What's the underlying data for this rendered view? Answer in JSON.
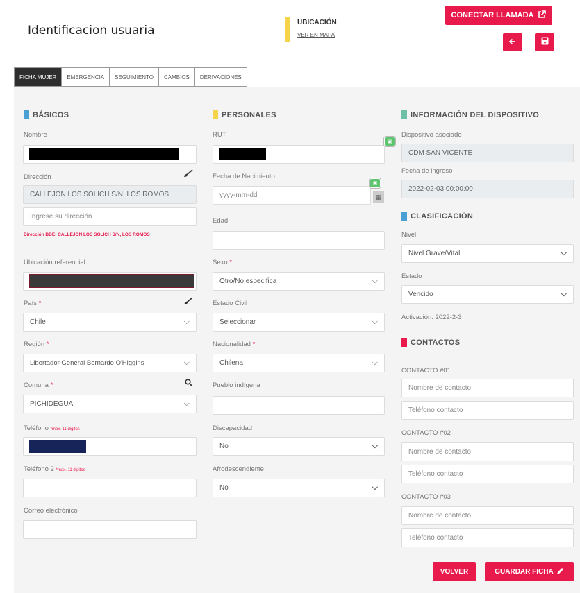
{
  "header": {
    "title": "Identificacion usuaria",
    "ubicacion_title": "UBICACIÓN",
    "ver_mapa": "VER EN MAPA",
    "call_label": "CONECTAR LLAMADA",
    "back_icon": "arrow-left-icon",
    "save_icon": "floppy-icon"
  },
  "tabs": [
    "FICHA MUJER",
    "EMERGENCIA",
    "SEGUIMIENTO",
    "CAMBIOS",
    "DERIVACIONES"
  ],
  "basicos": {
    "heading": "BÁSICOS",
    "nombre_label": "Nombre",
    "direccion_label": "Dirección",
    "direccion_value": "CALLEJON LOS SOLICH S/N, LOS ROMOS",
    "direccion_placeholder": "Ingrese su dirección",
    "direccion_warning": "Dirección BDE: CALLEJON LOS SOLICH S/N, LOS ROMOS",
    "ubicacion_label": "Ubicación referencial",
    "pais_label": "País",
    "pais_value": "Chile",
    "region_label": "Región",
    "region_value": "Libertador General Bernardo O'Higgins",
    "comuna_label": "Comuna",
    "comuna_value": "PICHIDEGUA",
    "telefono_label": "Teléfono",
    "telefono_hint": "*max. 11 digitos",
    "telefono2_label": "Teléfono 2",
    "telefono2_hint": "*max. 11 digitos",
    "correo_label": "Correo electrónico",
    "required_mark": "*"
  },
  "personales": {
    "heading": "PERSONALES",
    "rut_label": "RUT",
    "fecha_label": "Fecha de Nacimiento",
    "fecha_placeholder": "yyyy-mm-dd",
    "edad_label": "Edad",
    "sexo_label": "Sexo",
    "sexo_value": "Otro/No especifica",
    "civil_label": "Estado Civil",
    "civil_value": "Seleccionar",
    "nacionalidad_label": "Nacionalidad",
    "nacionalidad_value": "Chilena",
    "pueblo_label": "Pueblo indígena",
    "discapacidad_label": "Discapacidad",
    "discapacidad_value": "No",
    "afro_label": "Afrodescendiente",
    "afro_value": "No"
  },
  "dispositivo": {
    "heading": "INFORMACIÓN DEL DISPOSITIVO",
    "asociado_label": "Dispositivo asociado",
    "asociado_value": "CDM SAN VICENTE",
    "ingreso_label": "Fecha de ingreso",
    "ingreso_value": "2022-02-03 00:00:00"
  },
  "clasificacion": {
    "heading": "CLASIFICACIÓN",
    "nivel_label": "Nivel",
    "nivel_value": "Nivel Grave/Vital",
    "estado_label": "Estado",
    "estado_value": "Vencido",
    "activacion": "Activación: 2022-2-3"
  },
  "contactos": {
    "heading": "CONTACTOS",
    "items": [
      {
        "label": "CONTACTO #01",
        "name_placeholder": "Nombre de contacto",
        "phone_placeholder": "Teléfono contacto"
      },
      {
        "label": "CONTACTO #02",
        "name_placeholder": "Nombre de contacto",
        "phone_placeholder": "Teléfono contacto"
      },
      {
        "label": "CONTACTO #03",
        "name_placeholder": "Nombre de contacto",
        "phone_placeholder": "Teléfono contacto"
      }
    ]
  },
  "footer": {
    "volver": "VOLVER",
    "guardar": "GUARDAR FICHA"
  },
  "colors": {
    "accent": "#e8194b",
    "basicos_mark": "#4a9fd4",
    "personales_mark": "#f5d44a",
    "dispositivo_mark": "#6dbfa8",
    "contactos_mark": "#e8194b"
  }
}
